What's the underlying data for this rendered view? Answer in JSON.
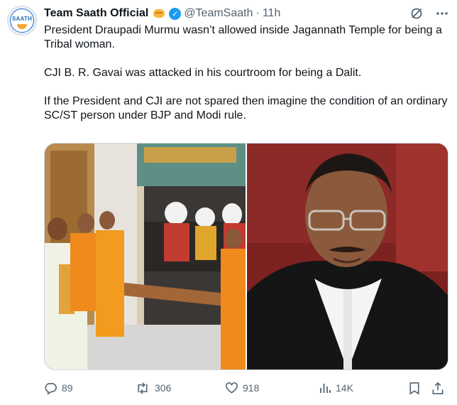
{
  "author": {
    "name": "Team Saath Official",
    "handle": "@TeamSaath",
    "separator": "·",
    "time": "11h",
    "avatar_text": "SAATH",
    "verified": true
  },
  "tweet": {
    "paragraphs": [
      "President Draupadi Murmu wasn’t allowed inside Jagannath Temple for being a Tribal woman.",
      "CJI B. R. Gavai was attacked in his courtroom for being a Dalit.",
      "If the President and CJI are not spared then imagine the condition of an ordinary SC/ST person under BJP and Modi rule."
    ]
  },
  "media": [
    {
      "description_icon": "temple-photo"
    },
    {
      "description_icon": "courtroom-photo"
    }
  ],
  "metrics": {
    "replies": "89",
    "reposts": "306",
    "likes": "918",
    "views": "14K"
  },
  "colors": {
    "text": "#0f1419",
    "muted": "#536471",
    "verified": "#1d9bf0",
    "border": "#cfd9de"
  }
}
